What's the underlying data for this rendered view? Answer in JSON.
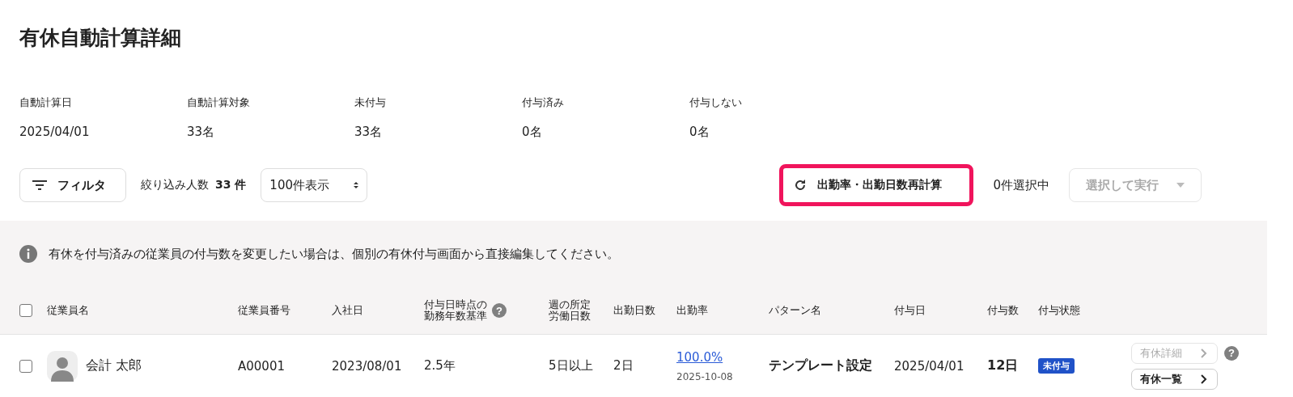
{
  "title": "有休自動計算詳細",
  "summary": [
    {
      "label": "自動計算日",
      "value": "2025/04/01"
    },
    {
      "label": "自動計算対象",
      "value": "33名"
    },
    {
      "label": "未付与",
      "value": "33名"
    },
    {
      "label": "付与済み",
      "value": "0名"
    },
    {
      "label": "付与しない",
      "value": "0名"
    }
  ],
  "toolbar": {
    "filter_button": "フィルタ",
    "filter_count_label": "絞り込み人数",
    "filter_count": "33 件",
    "page_size": "100件表示",
    "recalc_button": {
      "label": "出勤率・出勤日数再計算",
      "highlighted": true
    },
    "selection_count": "0件選択中",
    "action_select": {
      "label": "選択して実行",
      "disabled": true
    }
  },
  "notice": "有休を付与済みの従業員の付与数を変更したい場合は、個別の有休付与画面から直接編集してください。",
  "table": {
    "select_all_checked": false,
    "columns": [
      {
        "label": [
          "従業員名"
        ]
      },
      {
        "label": [
          "従業員番号"
        ]
      },
      {
        "label": [
          "入社日"
        ]
      },
      {
        "label": [
          "付与日時点の",
          "勤務年数基準"
        ],
        "help": "?"
      },
      {
        "label": [
          "週の所定",
          "労働日数"
        ]
      },
      {
        "label": [
          "出勤日数"
        ]
      },
      {
        "label": [
          "出勤率"
        ]
      },
      {
        "label": [
          "パターン名"
        ]
      },
      {
        "label": [
          "付与日"
        ]
      },
      {
        "label": [
          "付与数"
        ]
      },
      {
        "label": [
          "付与状態"
        ]
      }
    ],
    "rows": [
      {
        "checked": false,
        "name": "会計 太郎",
        "number": "A00001",
        "hire_date": "2023/08/01",
        "years": "2.5年",
        "weekly_days": "5日以上",
        "attendance_days": "2日",
        "attendance_rate": "100.0%",
        "rate_date": "2025-10-08",
        "pattern": "テンプレート設定",
        "grant_date": "2025/04/01",
        "grant_count": "12日",
        "status": "未付与",
        "detail_button": {
          "label": "有休詳細",
          "disabled": true
        },
        "help": "?",
        "list_button": {
          "label": "有休一覧",
          "disabled": false
        }
      }
    ]
  }
}
